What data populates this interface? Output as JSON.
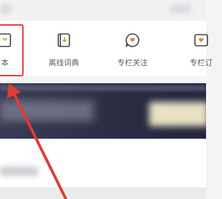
{
  "nav": {
    "items": [
      {
        "label": "本",
        "icon": "notebook-icon"
      },
      {
        "label": "离线词典",
        "icon": "dictionary-icon"
      },
      {
        "label": "专栏关注",
        "icon": "heart-chat-icon"
      },
      {
        "label": "专栏订",
        "icon": "column-subscribe-icon"
      }
    ]
  },
  "colors": {
    "highlight": "#e23a31",
    "accent": "#c89a36",
    "banner": "#2a2b44"
  }
}
